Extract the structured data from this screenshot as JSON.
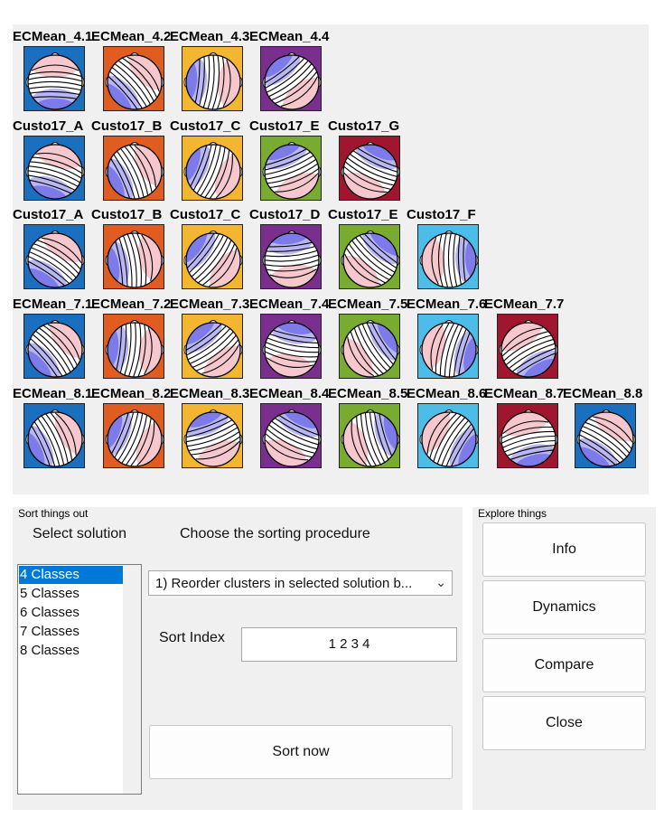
{
  "colors": {
    "tile_blue": "#1a6fbf",
    "tile_orange": "#e05c20",
    "tile_yellow": "#f2b630",
    "tile_purple": "#7a2f8e",
    "tile_green": "#78ab30",
    "tile_cyan": "#4cbde9",
    "tile_red": "#a0162e",
    "selection": "#0078d7"
  },
  "maps": {
    "rows": [
      {
        "titles": [
          "ECMean_4.1",
          "ECMean_4.2",
          "ECMean_4.3",
          "ECMean_4.4"
        ],
        "tile_colors": [
          "blue",
          "orange",
          "yellow",
          "purple"
        ]
      },
      {
        "titles": [
          "Custo17_A",
          "Custo17_B",
          "Custo17_C",
          "Custo17_E",
          "Custo17_G"
        ],
        "tile_colors": [
          "blue",
          "orange",
          "yellow",
          "green",
          "red"
        ]
      },
      {
        "titles": [
          "Custo17_A",
          "Custo17_B",
          "Custo17_C",
          "Custo17_D",
          "Custo17_E",
          "Custo17_F"
        ],
        "tile_colors": [
          "blue",
          "orange",
          "yellow",
          "purple",
          "green",
          "cyan"
        ]
      },
      {
        "titles": [
          "ECMean_7.1",
          "ECMean_7.2",
          "ECMean_7.3",
          "ECMean_7.4",
          "ECMean_7.5",
          "ECMean_7.6",
          "ECMean_7.7"
        ],
        "tile_colors": [
          "blue",
          "orange",
          "yellow",
          "purple",
          "green",
          "cyan",
          "red"
        ]
      },
      {
        "titles": [
          "ECMean_8.1",
          "ECMean_8.2",
          "ECMean_8.3",
          "ECMean_8.4",
          "ECMean_8.5",
          "ECMean_8.6",
          "ECMean_8.7",
          "ECMean_8.8"
        ],
        "tile_colors": [
          "blue",
          "orange",
          "yellow",
          "purple",
          "green",
          "cyan",
          "red",
          "blue"
        ]
      }
    ]
  },
  "sort_panel": {
    "title": "Sort things out",
    "select_solution_label": "Select solution",
    "procedure_label": "Choose the sorting procedure",
    "solutions": [
      "4 Classes",
      "5 Classes",
      "6 Classes",
      "7 Classes",
      "8 Classes"
    ],
    "selected_solution": "4 Classes",
    "procedure_value": "1) Reorder clusters in selected solution b...",
    "sort_index_label": "Sort Index",
    "sort_index_value": "1 2 3 4",
    "sort_button": "Sort now"
  },
  "explore_panel": {
    "title": "Explore things",
    "buttons": [
      "Info",
      "Dynamics",
      "Compare",
      "Close"
    ]
  }
}
